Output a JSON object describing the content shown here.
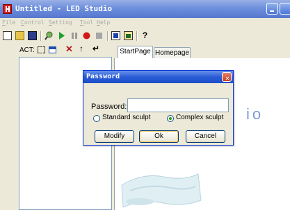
{
  "window": {
    "title": "Untitled - LED Studio"
  },
  "menubar": {
    "items": [
      "File",
      "Control",
      "Setting",
      "Tool",
      "Help"
    ]
  },
  "toolbar": {
    "icons": [
      "new-file-icon",
      "open-file-icon",
      "save-icon",
      "search-icon",
      "play-icon",
      "pause-icon",
      "record-icon",
      "stop-icon",
      "screen-icon",
      "window-icon",
      "help-icon"
    ]
  },
  "left_panel": {
    "act_label": "ACT:"
  },
  "tabs": [
    {
      "label": "StartPage"
    },
    {
      "label": "Homepage"
    }
  ],
  "background": {
    "watermark": "io"
  },
  "dialog": {
    "title": "Password",
    "password_label": "Password:",
    "password_value": "",
    "radio_standard": "Standard sculpt",
    "radio_complex": "Complex sculpt",
    "selected_option": "Complex sculpt",
    "modify_label": "Modify",
    "ok_label": "Ok",
    "cancel_label": "Cancel"
  },
  "colors": {
    "titlebar": "#5677cf",
    "dialog_title": "#2a5bd7",
    "close": "#c4401e",
    "watermark": "#7a9bd6"
  }
}
